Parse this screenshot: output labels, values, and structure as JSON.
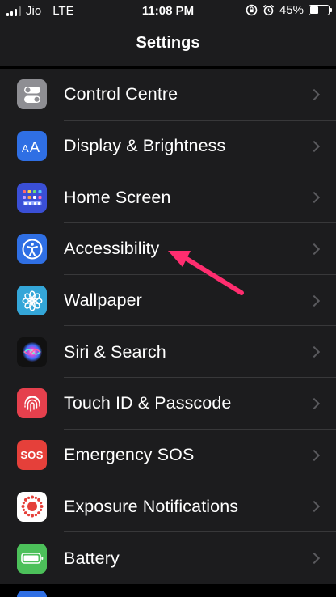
{
  "status": {
    "carrier": "Jio",
    "network": "LTE",
    "time": "11:08 PM",
    "battery": "45%",
    "battery_level": 0.45
  },
  "nav": {
    "title": "Settings"
  },
  "rows": [
    {
      "label": "Control Centre",
      "icon": "control-centre-icon",
      "color": "#8e8e93"
    },
    {
      "label": "Display & Brightness",
      "icon": "display-brightness-icon",
      "color": "#2f6fe4"
    },
    {
      "label": "Home Screen",
      "icon": "home-screen-icon",
      "color": "#3a4fd6"
    },
    {
      "label": "Accessibility",
      "icon": "accessibility-icon",
      "color": "#2f6fe4"
    },
    {
      "label": "Wallpaper",
      "icon": "wallpaper-icon",
      "color": "#34a6d8"
    },
    {
      "label": "Siri & Search",
      "icon": "siri-icon",
      "color": "#111111"
    },
    {
      "label": "Touch ID & Passcode",
      "icon": "touch-id-icon",
      "color": "#e5404d"
    },
    {
      "label": "Emergency SOS",
      "icon": "sos-icon",
      "color": "#e5403a",
      "icon_text": "SOS"
    },
    {
      "label": "Exposure Notifications",
      "icon": "exposure-notifications-icon",
      "color": "#ffffff"
    },
    {
      "label": "Battery",
      "icon": "battery-settings-icon",
      "color": "#4cc05a"
    }
  ],
  "annotation": {
    "arrow_color": "#ff2d6f"
  }
}
